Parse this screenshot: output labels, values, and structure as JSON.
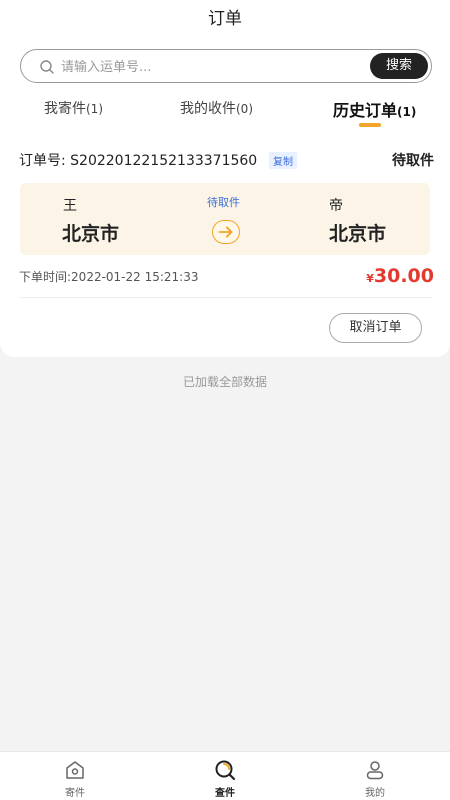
{
  "header": {
    "title": "订单"
  },
  "search": {
    "placeholder": "请输入运单号...",
    "value": "",
    "button_label": "搜索",
    "icon": "search-icon"
  },
  "tabs": [
    {
      "label": "我寄件",
      "count": "(1)"
    },
    {
      "label": "我的收件",
      "count": "(0)"
    },
    {
      "label": "历史订单",
      "count": "(1)",
      "active": true
    }
  ],
  "order": {
    "order_no": "订单号: S20220122152133371560",
    "copy_label": "复制",
    "status": "待取件",
    "sender_name": "王",
    "sender_city": "北京市",
    "route_status": "待取件",
    "receiver_name": "帝",
    "receiver_city": "北京市",
    "time": "下单时间:2022-01-22 15:21:33",
    "currency": "¥",
    "price": "30.00",
    "cancel_label": "取消订单"
  },
  "loaded_text": "已加载全部数据",
  "tabbar": [
    {
      "label": "寄件",
      "icon": "home-icon"
    },
    {
      "label": "查件",
      "icon": "search-query-icon",
      "active": true
    },
    {
      "label": "我的",
      "icon": "user-icon"
    }
  ],
  "colors": {
    "accent": "#f2a52b",
    "price": "#e23a2e",
    "link": "#3b6ed6"
  }
}
